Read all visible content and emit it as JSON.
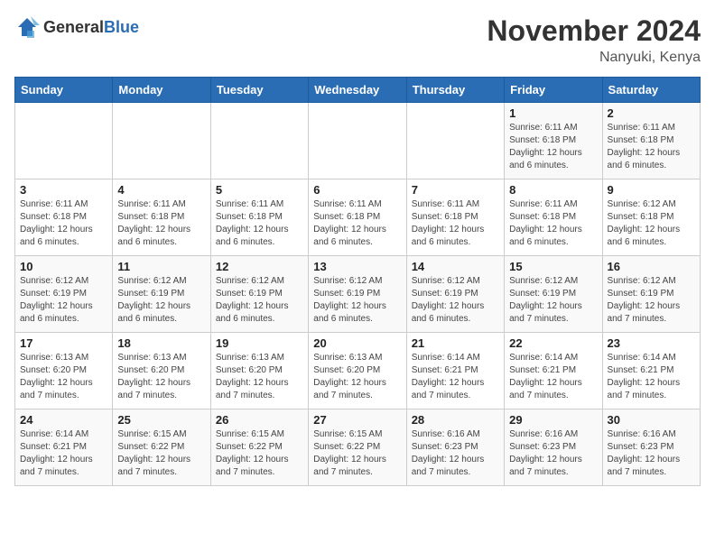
{
  "logo": {
    "general": "General",
    "blue": "Blue"
  },
  "title": "November 2024",
  "location": "Nanyuki, Kenya",
  "days_of_week": [
    "Sunday",
    "Monday",
    "Tuesday",
    "Wednesday",
    "Thursday",
    "Friday",
    "Saturday"
  ],
  "weeks": [
    [
      {
        "day": "",
        "info": ""
      },
      {
        "day": "",
        "info": ""
      },
      {
        "day": "",
        "info": ""
      },
      {
        "day": "",
        "info": ""
      },
      {
        "day": "",
        "info": ""
      },
      {
        "day": "1",
        "info": "Sunrise: 6:11 AM\nSunset: 6:18 PM\nDaylight: 12 hours and 6 minutes."
      },
      {
        "day": "2",
        "info": "Sunrise: 6:11 AM\nSunset: 6:18 PM\nDaylight: 12 hours and 6 minutes."
      }
    ],
    [
      {
        "day": "3",
        "info": "Sunrise: 6:11 AM\nSunset: 6:18 PM\nDaylight: 12 hours and 6 minutes."
      },
      {
        "day": "4",
        "info": "Sunrise: 6:11 AM\nSunset: 6:18 PM\nDaylight: 12 hours and 6 minutes."
      },
      {
        "day": "5",
        "info": "Sunrise: 6:11 AM\nSunset: 6:18 PM\nDaylight: 12 hours and 6 minutes."
      },
      {
        "day": "6",
        "info": "Sunrise: 6:11 AM\nSunset: 6:18 PM\nDaylight: 12 hours and 6 minutes."
      },
      {
        "day": "7",
        "info": "Sunrise: 6:11 AM\nSunset: 6:18 PM\nDaylight: 12 hours and 6 minutes."
      },
      {
        "day": "8",
        "info": "Sunrise: 6:11 AM\nSunset: 6:18 PM\nDaylight: 12 hours and 6 minutes."
      },
      {
        "day": "9",
        "info": "Sunrise: 6:12 AM\nSunset: 6:18 PM\nDaylight: 12 hours and 6 minutes."
      }
    ],
    [
      {
        "day": "10",
        "info": "Sunrise: 6:12 AM\nSunset: 6:19 PM\nDaylight: 12 hours and 6 minutes."
      },
      {
        "day": "11",
        "info": "Sunrise: 6:12 AM\nSunset: 6:19 PM\nDaylight: 12 hours and 6 minutes."
      },
      {
        "day": "12",
        "info": "Sunrise: 6:12 AM\nSunset: 6:19 PM\nDaylight: 12 hours and 6 minutes."
      },
      {
        "day": "13",
        "info": "Sunrise: 6:12 AM\nSunset: 6:19 PM\nDaylight: 12 hours and 6 minutes."
      },
      {
        "day": "14",
        "info": "Sunrise: 6:12 AM\nSunset: 6:19 PM\nDaylight: 12 hours and 6 minutes."
      },
      {
        "day": "15",
        "info": "Sunrise: 6:12 AM\nSunset: 6:19 PM\nDaylight: 12 hours and 7 minutes."
      },
      {
        "day": "16",
        "info": "Sunrise: 6:12 AM\nSunset: 6:19 PM\nDaylight: 12 hours and 7 minutes."
      }
    ],
    [
      {
        "day": "17",
        "info": "Sunrise: 6:13 AM\nSunset: 6:20 PM\nDaylight: 12 hours and 7 minutes."
      },
      {
        "day": "18",
        "info": "Sunrise: 6:13 AM\nSunset: 6:20 PM\nDaylight: 12 hours and 7 minutes."
      },
      {
        "day": "19",
        "info": "Sunrise: 6:13 AM\nSunset: 6:20 PM\nDaylight: 12 hours and 7 minutes."
      },
      {
        "day": "20",
        "info": "Sunrise: 6:13 AM\nSunset: 6:20 PM\nDaylight: 12 hours and 7 minutes."
      },
      {
        "day": "21",
        "info": "Sunrise: 6:14 AM\nSunset: 6:21 PM\nDaylight: 12 hours and 7 minutes."
      },
      {
        "day": "22",
        "info": "Sunrise: 6:14 AM\nSunset: 6:21 PM\nDaylight: 12 hours and 7 minutes."
      },
      {
        "day": "23",
        "info": "Sunrise: 6:14 AM\nSunset: 6:21 PM\nDaylight: 12 hours and 7 minutes."
      }
    ],
    [
      {
        "day": "24",
        "info": "Sunrise: 6:14 AM\nSunset: 6:21 PM\nDaylight: 12 hours and 7 minutes."
      },
      {
        "day": "25",
        "info": "Sunrise: 6:15 AM\nSunset: 6:22 PM\nDaylight: 12 hours and 7 minutes."
      },
      {
        "day": "26",
        "info": "Sunrise: 6:15 AM\nSunset: 6:22 PM\nDaylight: 12 hours and 7 minutes."
      },
      {
        "day": "27",
        "info": "Sunrise: 6:15 AM\nSunset: 6:22 PM\nDaylight: 12 hours and 7 minutes."
      },
      {
        "day": "28",
        "info": "Sunrise: 6:16 AM\nSunset: 6:23 PM\nDaylight: 12 hours and 7 minutes."
      },
      {
        "day": "29",
        "info": "Sunrise: 6:16 AM\nSunset: 6:23 PM\nDaylight: 12 hours and 7 minutes."
      },
      {
        "day": "30",
        "info": "Sunrise: 6:16 AM\nSunset: 6:23 PM\nDaylight: 12 hours and 7 minutes."
      }
    ]
  ]
}
